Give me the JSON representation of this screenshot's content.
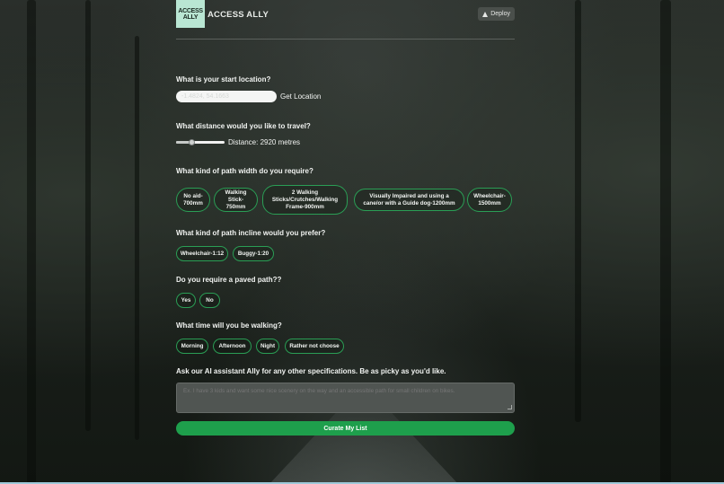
{
  "app": {
    "logo_text": "ACCESS\nALLY",
    "title": "ACCESS ALLY",
    "deploy_label": "Deploy"
  },
  "location": {
    "question": "What is your start location?",
    "input_value": "-1.4824, 54.1663",
    "get_location_label": "Get Location"
  },
  "distance": {
    "question": "What distance would you like to travel?",
    "label": "Distance: 2920 metres",
    "slider_fraction": 0.29
  },
  "width": {
    "question": "What kind of path width do you require?",
    "options": [
      "No aid-700mm",
      "Walking Stick-750mm",
      "2 Walking Sticks/Crutches/Walking Frame-900mm",
      "Visually Impaired and using a cane/or with a Guide dog-1200mm",
      "Wheelchair-1500mm"
    ]
  },
  "incline": {
    "question": "What kind of path incline would you prefer?",
    "options": [
      "Wheelchair-1:12",
      "Buggy-1:20"
    ]
  },
  "paved": {
    "question": "Do you require a paved path??",
    "options": [
      "Yes",
      "No"
    ]
  },
  "time": {
    "question": "What time will you be walking?",
    "options": [
      "Morning",
      "Afternoon",
      "Night",
      "Rather not choose"
    ]
  },
  "ai": {
    "prompt": "Ask our AI assistant Ally for any other specifications. Be as picky as you'd like.",
    "placeholder": "Ex. I have 3 kids and want some nice scenery on the way and an accessible path for small children on bikes."
  },
  "submit_label": "Curate My List",
  "colors": {
    "accent": "#1e9f4c",
    "pill_border": "#2a9e55",
    "logo_bg": "#b9e6d3"
  }
}
